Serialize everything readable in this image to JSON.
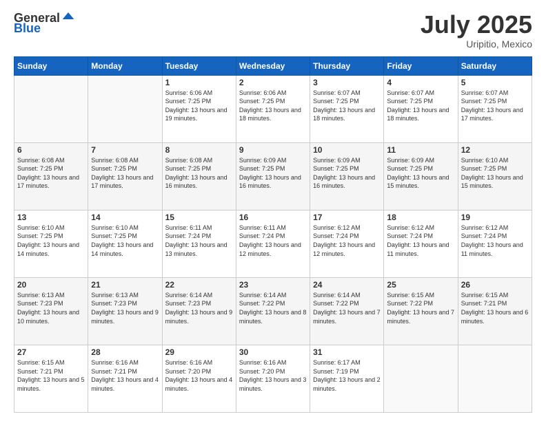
{
  "header": {
    "logo_general": "General",
    "logo_blue": "Blue",
    "month": "July 2025",
    "location": "Uripitio, Mexico"
  },
  "weekdays": [
    "Sunday",
    "Monday",
    "Tuesday",
    "Wednesday",
    "Thursday",
    "Friday",
    "Saturday"
  ],
  "rows": [
    [
      {
        "day": "",
        "sunrise": "",
        "sunset": "",
        "daylight": ""
      },
      {
        "day": "",
        "sunrise": "",
        "sunset": "",
        "daylight": ""
      },
      {
        "day": "1",
        "sunrise": "Sunrise: 6:06 AM",
        "sunset": "Sunset: 7:25 PM",
        "daylight": "Daylight: 13 hours and 19 minutes."
      },
      {
        "day": "2",
        "sunrise": "Sunrise: 6:06 AM",
        "sunset": "Sunset: 7:25 PM",
        "daylight": "Daylight: 13 hours and 18 minutes."
      },
      {
        "day": "3",
        "sunrise": "Sunrise: 6:07 AM",
        "sunset": "Sunset: 7:25 PM",
        "daylight": "Daylight: 13 hours and 18 minutes."
      },
      {
        "day": "4",
        "sunrise": "Sunrise: 6:07 AM",
        "sunset": "Sunset: 7:25 PM",
        "daylight": "Daylight: 13 hours and 18 minutes."
      },
      {
        "day": "5",
        "sunrise": "Sunrise: 6:07 AM",
        "sunset": "Sunset: 7:25 PM",
        "daylight": "Daylight: 13 hours and 17 minutes."
      }
    ],
    [
      {
        "day": "6",
        "sunrise": "Sunrise: 6:08 AM",
        "sunset": "Sunset: 7:25 PM",
        "daylight": "Daylight: 13 hours and 17 minutes."
      },
      {
        "day": "7",
        "sunrise": "Sunrise: 6:08 AM",
        "sunset": "Sunset: 7:25 PM",
        "daylight": "Daylight: 13 hours and 17 minutes."
      },
      {
        "day": "8",
        "sunrise": "Sunrise: 6:08 AM",
        "sunset": "Sunset: 7:25 PM",
        "daylight": "Daylight: 13 hours and 16 minutes."
      },
      {
        "day": "9",
        "sunrise": "Sunrise: 6:09 AM",
        "sunset": "Sunset: 7:25 PM",
        "daylight": "Daylight: 13 hours and 16 minutes."
      },
      {
        "day": "10",
        "sunrise": "Sunrise: 6:09 AM",
        "sunset": "Sunset: 7:25 PM",
        "daylight": "Daylight: 13 hours and 16 minutes."
      },
      {
        "day": "11",
        "sunrise": "Sunrise: 6:09 AM",
        "sunset": "Sunset: 7:25 PM",
        "daylight": "Daylight: 13 hours and 15 minutes."
      },
      {
        "day": "12",
        "sunrise": "Sunrise: 6:10 AM",
        "sunset": "Sunset: 7:25 PM",
        "daylight": "Daylight: 13 hours and 15 minutes."
      }
    ],
    [
      {
        "day": "13",
        "sunrise": "Sunrise: 6:10 AM",
        "sunset": "Sunset: 7:25 PM",
        "daylight": "Daylight: 13 hours and 14 minutes."
      },
      {
        "day": "14",
        "sunrise": "Sunrise: 6:10 AM",
        "sunset": "Sunset: 7:25 PM",
        "daylight": "Daylight: 13 hours and 14 minutes."
      },
      {
        "day": "15",
        "sunrise": "Sunrise: 6:11 AM",
        "sunset": "Sunset: 7:24 PM",
        "daylight": "Daylight: 13 hours and 13 minutes."
      },
      {
        "day": "16",
        "sunrise": "Sunrise: 6:11 AM",
        "sunset": "Sunset: 7:24 PM",
        "daylight": "Daylight: 13 hours and 12 minutes."
      },
      {
        "day": "17",
        "sunrise": "Sunrise: 6:12 AM",
        "sunset": "Sunset: 7:24 PM",
        "daylight": "Daylight: 13 hours and 12 minutes."
      },
      {
        "day": "18",
        "sunrise": "Sunrise: 6:12 AM",
        "sunset": "Sunset: 7:24 PM",
        "daylight": "Daylight: 13 hours and 11 minutes."
      },
      {
        "day": "19",
        "sunrise": "Sunrise: 6:12 AM",
        "sunset": "Sunset: 7:24 PM",
        "daylight": "Daylight: 13 hours and 11 minutes."
      }
    ],
    [
      {
        "day": "20",
        "sunrise": "Sunrise: 6:13 AM",
        "sunset": "Sunset: 7:23 PM",
        "daylight": "Daylight: 13 hours and 10 minutes."
      },
      {
        "day": "21",
        "sunrise": "Sunrise: 6:13 AM",
        "sunset": "Sunset: 7:23 PM",
        "daylight": "Daylight: 13 hours and 9 minutes."
      },
      {
        "day": "22",
        "sunrise": "Sunrise: 6:14 AM",
        "sunset": "Sunset: 7:23 PM",
        "daylight": "Daylight: 13 hours and 9 minutes."
      },
      {
        "day": "23",
        "sunrise": "Sunrise: 6:14 AM",
        "sunset": "Sunset: 7:22 PM",
        "daylight": "Daylight: 13 hours and 8 minutes."
      },
      {
        "day": "24",
        "sunrise": "Sunrise: 6:14 AM",
        "sunset": "Sunset: 7:22 PM",
        "daylight": "Daylight: 13 hours and 7 minutes."
      },
      {
        "day": "25",
        "sunrise": "Sunrise: 6:15 AM",
        "sunset": "Sunset: 7:22 PM",
        "daylight": "Daylight: 13 hours and 7 minutes."
      },
      {
        "day": "26",
        "sunrise": "Sunrise: 6:15 AM",
        "sunset": "Sunset: 7:21 PM",
        "daylight": "Daylight: 13 hours and 6 minutes."
      }
    ],
    [
      {
        "day": "27",
        "sunrise": "Sunrise: 6:15 AM",
        "sunset": "Sunset: 7:21 PM",
        "daylight": "Daylight: 13 hours and 5 minutes."
      },
      {
        "day": "28",
        "sunrise": "Sunrise: 6:16 AM",
        "sunset": "Sunset: 7:21 PM",
        "daylight": "Daylight: 13 hours and 4 minutes."
      },
      {
        "day": "29",
        "sunrise": "Sunrise: 6:16 AM",
        "sunset": "Sunset: 7:20 PM",
        "daylight": "Daylight: 13 hours and 4 minutes."
      },
      {
        "day": "30",
        "sunrise": "Sunrise: 6:16 AM",
        "sunset": "Sunset: 7:20 PM",
        "daylight": "Daylight: 13 hours and 3 minutes."
      },
      {
        "day": "31",
        "sunrise": "Sunrise: 6:17 AM",
        "sunset": "Sunset: 7:19 PM",
        "daylight": "Daylight: 13 hours and 2 minutes."
      },
      {
        "day": "",
        "sunrise": "",
        "sunset": "",
        "daylight": ""
      },
      {
        "day": "",
        "sunrise": "",
        "sunset": "",
        "daylight": ""
      }
    ]
  ]
}
